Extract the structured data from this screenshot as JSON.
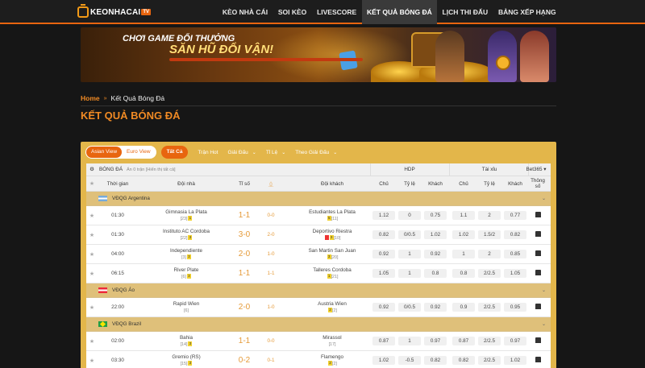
{
  "logo": {
    "text": "KEONHACAI",
    "badge": "TV"
  },
  "nav": {
    "items": [
      {
        "label": "KÈO NHÀ CÁI",
        "active": false
      },
      {
        "label": "SOI KÈO",
        "active": false
      },
      {
        "label": "LIVESCORE",
        "active": false
      },
      {
        "label": "KẾT QUẢ BÓNG ĐÁ",
        "active": true
      },
      {
        "label": "LỊCH THI ĐẤU",
        "active": false
      },
      {
        "label": "BẢNG XẾP HẠNG",
        "active": false
      }
    ]
  },
  "banner": {
    "line1": "CHƠI GAME ĐỔI THƯỞNG",
    "line2": "SĂN HŨ ĐỔI VẬN!"
  },
  "breadcrumb": {
    "home": "Home",
    "separator": "»",
    "current": "Kết Quả Bóng Đá"
  },
  "page_title": "KẾT QUẢ BÓNG ĐÁ",
  "filters": {
    "view_asian": "Asian View",
    "view_euro": "Euro View",
    "tab_all": "Tất Cả",
    "tab_hot": "Trận Hot",
    "giai_dau": "Giải Đấu",
    "ti_le": "Tỉ Lệ",
    "theo_giai_dau": "Theo Giải Đấu"
  },
  "table_header": {
    "sport": "BÓNG ĐÁ",
    "hidden": "Ẩn 0 trận [Hiển thị tất cả]",
    "hdp": "HDP",
    "taixiu": "Tài xỉu",
    "bookmaker": "Bet365",
    "time": "Thời gian",
    "home": "Đội nhà",
    "score": "Tỉ số",
    "away": "Đội khách",
    "chu1": "Chủ",
    "tyle1": "Tỷ lệ",
    "khach1": "Khách",
    "chu2": "Chủ",
    "tyle2": "Tỷ lệ",
    "khach2": "Khách",
    "thongso": "Thông số"
  },
  "leagues": [
    {
      "name": "VĐQG Argentina",
      "flag": "arg",
      "matches": [
        {
          "time": "01:30",
          "home": "Gimnasia La Plata",
          "home_rank": "[23]",
          "home_card": "1",
          "home_card_color": "y",
          "score": "1-1",
          "ht": "0-0",
          "away": "Estudiantes La Plata",
          "away_rank": "[11]",
          "away_card": "5",
          "away_card_color": "y",
          "odds": [
            "1.12",
            "0",
            "0.75",
            "1.1",
            "2",
            "0.77"
          ]
        },
        {
          "time": "01:30",
          "home": "Instituto AC Cordoba",
          "home_rank": "[22]",
          "home_card": "3",
          "home_card_color": "y",
          "score": "3-0",
          "ht": "2-0",
          "away": "Deportivo Riestra",
          "away_rank": "[10]",
          "away_card": "3",
          "away_card_color": "y",
          "odds": [
            "0.82",
            "0/0.5",
            "1.02",
            "1.02",
            "1.5/2",
            "0.82"
          ]
        },
        {
          "time": "04:00",
          "home": "Independiente",
          "home_rank": "[3]",
          "home_card": "3",
          "home_card_color": "y",
          "score": "2-0",
          "ht": "1-0",
          "away": "San Martin San Juan",
          "away_rank": "[20]",
          "away_card": "3",
          "away_card_color": "y",
          "odds": [
            "0.92",
            "1",
            "0.92",
            "1",
            "2",
            "0.85"
          ]
        },
        {
          "time": "06:15",
          "home": "River Plate",
          "home_rank": "[6]",
          "home_card": "3",
          "home_card_color": "y",
          "score": "1-1",
          "ht": "1-1",
          "away": "Talleres Cordoba",
          "away_rank": "[21]",
          "away_card": "1",
          "away_card_color": "y",
          "odds": [
            "1.05",
            "1",
            "0.8",
            "0.8",
            "2/2.5",
            "1.05"
          ]
        }
      ]
    },
    {
      "name": "VĐQG Áo",
      "flag": "aut",
      "matches": [
        {
          "time": "22:00",
          "home": "Rapid Wien",
          "home_rank": "[6]",
          "home_card": "",
          "home_card_color": "y",
          "score": "2-0",
          "ht": "1-0",
          "away": "Austria Wien",
          "away_rank": "[2]",
          "away_card": "2",
          "away_card_color": "y",
          "odds": [
            "0.92",
            "0/0.5",
            "0.92",
            "0.9",
            "2/2.5",
            "0.95"
          ]
        }
      ]
    },
    {
      "name": "VĐQG Brazil",
      "flag": "bra",
      "matches": [
        {
          "time": "02:00",
          "home": "Bahia",
          "home_rank": "[14]",
          "home_card": "3",
          "home_card_color": "y",
          "score": "1-1",
          "ht": "0-0",
          "away": "Mirassol",
          "away_rank": "[17]",
          "away_card": "",
          "away_card_color": "y",
          "odds": [
            "0.87",
            "1",
            "0.97",
            "0.87",
            "2/2.5",
            "0.97"
          ]
        },
        {
          "time": "03:30",
          "home": "Gremio (RS)",
          "home_rank": "[15]",
          "home_card": "3",
          "home_card_color": "y",
          "score": "0-2",
          "ht": "0-1",
          "away": "Flamengo",
          "away_rank": "[2]",
          "away_card": "2",
          "away_card_color": "y",
          "odds": [
            "1.02",
            "-0.5",
            "0.82",
            "0.82",
            "2/2.5",
            "1.02"
          ]
        }
      ]
    }
  ]
}
